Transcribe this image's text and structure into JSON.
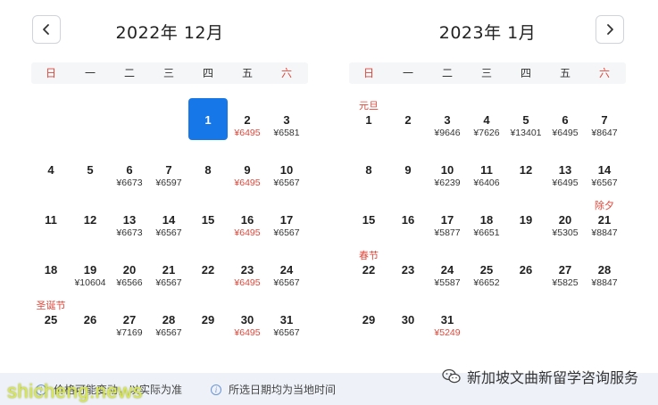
{
  "nav": {
    "prev_icon": "chevron-left-icon",
    "next_icon": "chevron-right-icon"
  },
  "weekdays": [
    "日",
    "一",
    "二",
    "三",
    "四",
    "五",
    "六"
  ],
  "months": [
    {
      "title": "2022年 12月",
      "first_weekday": 4,
      "days": [
        {
          "d": "1",
          "selected": true
        },
        {
          "d": "2",
          "price": "¥6495",
          "low": true
        },
        {
          "d": "3",
          "price": "¥6581"
        },
        {
          "d": "4"
        },
        {
          "d": "5"
        },
        {
          "d": "6",
          "price": "¥6673"
        },
        {
          "d": "7",
          "price": "¥6597"
        },
        {
          "d": "8"
        },
        {
          "d": "9",
          "price": "¥6495",
          "low": true
        },
        {
          "d": "10",
          "price": "¥6567"
        },
        {
          "d": "11"
        },
        {
          "d": "12"
        },
        {
          "d": "13",
          "price": "¥6673"
        },
        {
          "d": "14",
          "price": "¥6567"
        },
        {
          "d": "15"
        },
        {
          "d": "16",
          "price": "¥6495",
          "low": true
        },
        {
          "d": "17",
          "price": "¥6567"
        },
        {
          "d": "18"
        },
        {
          "d": "19",
          "price": "¥10604"
        },
        {
          "d": "20",
          "price": "¥6566"
        },
        {
          "d": "21",
          "price": "¥6567"
        },
        {
          "d": "22"
        },
        {
          "d": "23",
          "price": "¥6495",
          "low": true
        },
        {
          "d": "24",
          "price": "¥6567"
        },
        {
          "d": "25",
          "holiday": "圣诞节"
        },
        {
          "d": "26"
        },
        {
          "d": "27",
          "price": "¥7169"
        },
        {
          "d": "28",
          "price": "¥6567"
        },
        {
          "d": "29"
        },
        {
          "d": "30",
          "price": "¥6495",
          "low": true
        },
        {
          "d": "31",
          "price": "¥6567"
        }
      ]
    },
    {
      "title": "2023年 1月",
      "first_weekday": 0,
      "days": [
        {
          "d": "1",
          "holiday": "元旦"
        },
        {
          "d": "2"
        },
        {
          "d": "3",
          "price": "¥9646"
        },
        {
          "d": "4",
          "price": "¥7626"
        },
        {
          "d": "5",
          "price": "¥13401"
        },
        {
          "d": "6",
          "price": "¥6495"
        },
        {
          "d": "7",
          "price": "¥8647"
        },
        {
          "d": "8"
        },
        {
          "d": "9"
        },
        {
          "d": "10",
          "price": "¥6239"
        },
        {
          "d": "11",
          "price": "¥6406"
        },
        {
          "d": "12"
        },
        {
          "d": "13",
          "price": "¥6495"
        },
        {
          "d": "14",
          "price": "¥6567"
        },
        {
          "d": "15"
        },
        {
          "d": "16"
        },
        {
          "d": "17",
          "price": "¥5877"
        },
        {
          "d": "18",
          "price": "¥6651"
        },
        {
          "d": "19"
        },
        {
          "d": "20",
          "price": "¥5305"
        },
        {
          "d": "21",
          "price": "¥8847",
          "holiday": "除夕"
        },
        {
          "d": "22",
          "holiday": "春节"
        },
        {
          "d": "23"
        },
        {
          "d": "24",
          "price": "¥5587"
        },
        {
          "d": "25",
          "price": "¥6652"
        },
        {
          "d": "26"
        },
        {
          "d": "27",
          "price": "¥5825"
        },
        {
          "d": "28",
          "price": "¥8847"
        },
        {
          "d": "29"
        },
        {
          "d": "30"
        },
        {
          "d": "31",
          "price": "¥5249",
          "low": true
        }
      ]
    }
  ],
  "footer": {
    "note1": "价格可能变动，以实际为准",
    "note2": "所选日期均为当地时间",
    "info_icon": "info-icon"
  },
  "watermark": {
    "left": "shicheng.news",
    "right": "新加坡文曲新留学咨询服务",
    "right_icon": "wechat-icon"
  },
  "colors": {
    "accent": "#1677e8",
    "low_price": "#e0473a",
    "weekend": "#e0473a",
    "weekbar_bg": "#f5f6f8",
    "footer_bg": "#eef2f8"
  }
}
